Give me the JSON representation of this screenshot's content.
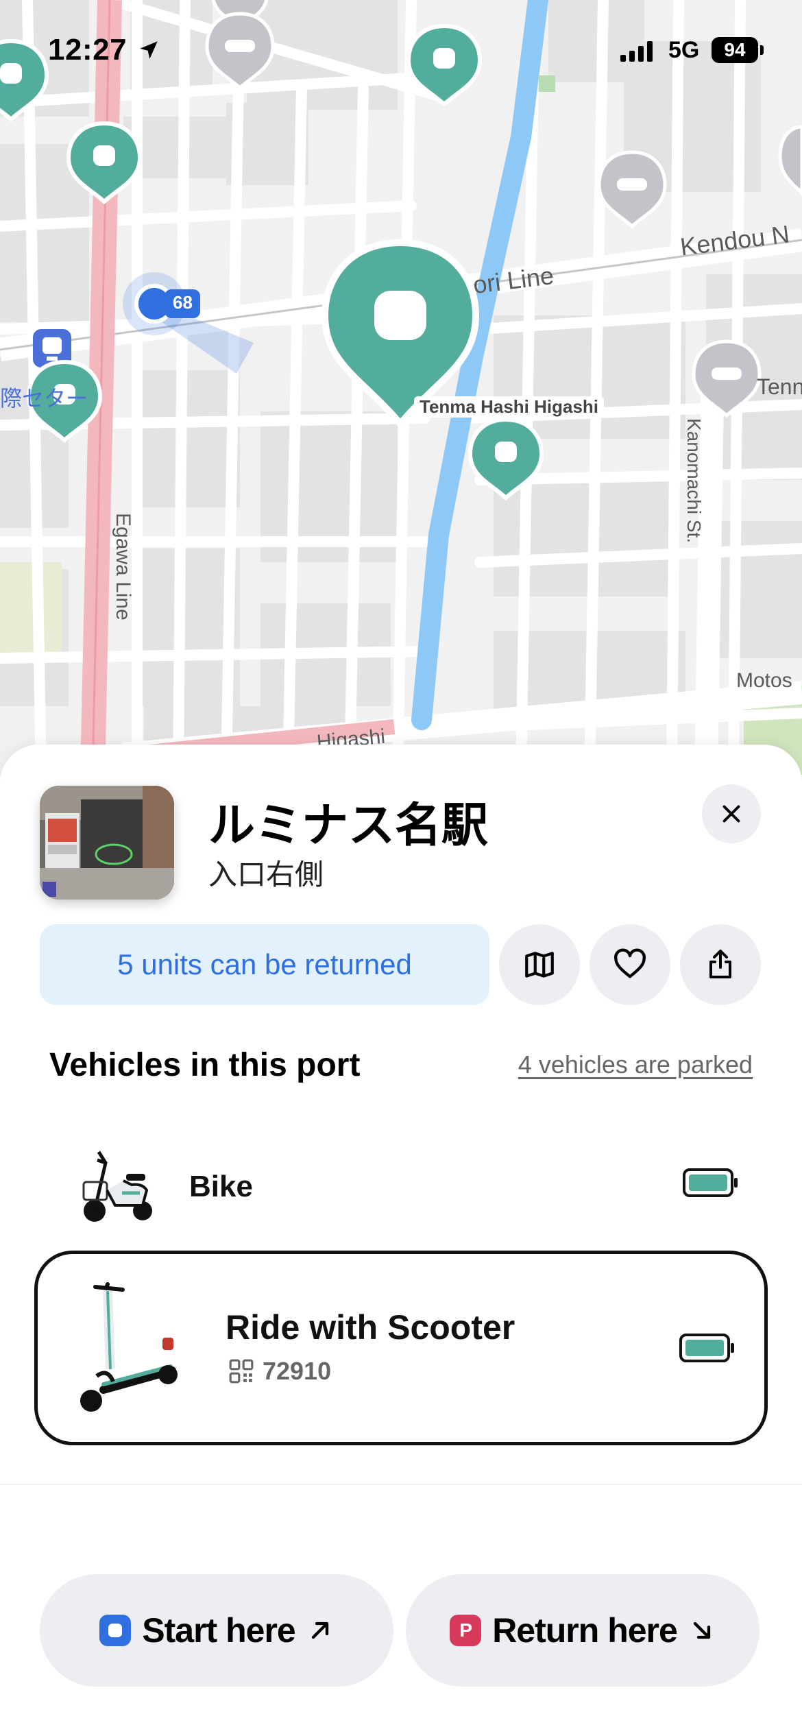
{
  "status_bar": {
    "time": "12:27",
    "network": "5G",
    "battery": "94"
  },
  "map": {
    "labels": {
      "kendou": "Kendou N",
      "dori_line": "ori Line",
      "route_number": "68",
      "tenma": "Tenma Hashi Higashi",
      "tenn": "Tenn",
      "kanomachi": "Kanomachi St.",
      "egawa": "Egawa Line",
      "motos": "Motos",
      "higashi": "Higashi",
      "station_jp": "際セター"
    },
    "colors": {
      "port": "#52ad9c",
      "port_inactive": "#c2c4c9",
      "river": "#8ec8f6",
      "main_road": "#f3b8bd",
      "user": "#2f6fe0"
    }
  },
  "sheet": {
    "port_name": "ルミナス名駅",
    "port_subtitle": "入口右側",
    "return_capacity": "5 units can be returned",
    "section_title": "Vehicles in this port",
    "parked_link": "4 vehicles are parked",
    "vehicles": [
      {
        "name": "Bike",
        "battery_level": 1.0,
        "selected": false
      },
      {
        "name": "Ride with Scooter",
        "code": "72910",
        "battery_level": 1.0,
        "selected": true
      }
    ],
    "start_label": "Start here",
    "return_label": "Return here",
    "return_badge": "P"
  },
  "icons": {
    "close": "close-icon",
    "map": "map-icon",
    "favorite": "heart-icon",
    "share": "share-icon",
    "qr": "qr-code-icon",
    "start_arrow": "arrow-up-right-icon",
    "return_arrow": "arrow-down-right-icon"
  }
}
